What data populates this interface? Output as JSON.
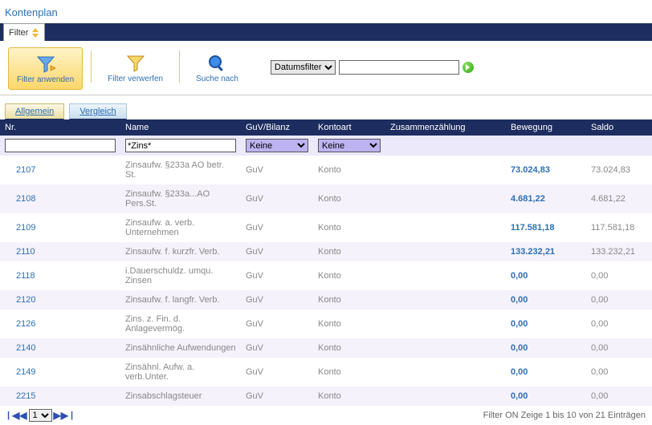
{
  "title": "Kontenplan",
  "filterTab": "Filter",
  "toolbar": {
    "apply": "Filter anwenden",
    "discard": "Filter verwerfen",
    "search": "Suche nach",
    "dateFilter": "Datumsfilter"
  },
  "tabs": {
    "allgemein": "Allgemein",
    "vergleich": "Vergleich"
  },
  "columns": {
    "nr": "Nr.",
    "name": "Name",
    "guv": "GuV/Bilanz",
    "kontoart": "Kontoart",
    "zus": "Zusammenzählung",
    "bew": "Bewegung",
    "saldo": "Saldo"
  },
  "filters": {
    "nr": "",
    "name": "*Zins*",
    "guv": "Keine",
    "kontoart": "Keine"
  },
  "rows": [
    {
      "nr": "2107",
      "name": "Zinsaufw. §233a AO betr. St.",
      "guv": "GuV",
      "kontoart": "Konto",
      "zus": "",
      "bew": "73.024,83",
      "saldo": "73.024,83"
    },
    {
      "nr": "2108",
      "name": "Zinsaufw. §233a...AO Pers.St.",
      "guv": "GuV",
      "kontoart": "Konto",
      "zus": "",
      "bew": "4.681,22",
      "saldo": "4.681,22"
    },
    {
      "nr": "2109",
      "name": "Zinsaufw. a. verb. Unternehmen",
      "guv": "GuV",
      "kontoart": "Konto",
      "zus": "",
      "bew": "117.581,18",
      "saldo": "117.581,18"
    },
    {
      "nr": "2110",
      "name": "Zinsaufw. f. kurzfr. Verb.",
      "guv": "GuV",
      "kontoart": "Konto",
      "zus": "",
      "bew": "133.232,21",
      "saldo": "133.232,21"
    },
    {
      "nr": "2118",
      "name": "i.Dauerschuldz. umqu. Zinsen",
      "guv": "GuV",
      "kontoart": "Konto",
      "zus": "",
      "bew": "0,00",
      "saldo": "0,00"
    },
    {
      "nr": "2120",
      "name": "Zinsaufw. f. langfr. Verb.",
      "guv": "GuV",
      "kontoart": "Konto",
      "zus": "",
      "bew": "0,00",
      "saldo": "0,00"
    },
    {
      "nr": "2126",
      "name": "Zins. z. Fin. d. Anlagevermög.",
      "guv": "GuV",
      "kontoart": "Konto",
      "zus": "",
      "bew": "0,00",
      "saldo": "0,00"
    },
    {
      "nr": "2140",
      "name": "Zinsähnliche Aufwendungen",
      "guv": "GuV",
      "kontoart": "Konto",
      "zus": "",
      "bew": "0,00",
      "saldo": "0,00"
    },
    {
      "nr": "2149",
      "name": "Zinsähnl. Aufw. a. verb.Unter.",
      "guv": "GuV",
      "kontoart": "Konto",
      "zus": "",
      "bew": "0,00",
      "saldo": "0,00"
    },
    {
      "nr": "2215",
      "name": "Zinsabschlagsteuer",
      "guv": "GuV",
      "kontoart": "Konto",
      "zus": "",
      "bew": "0,00",
      "saldo": "0,00"
    }
  ],
  "pager": {
    "current": "1"
  },
  "footer": "Filter ON  Zeige 1 bis 10 von 21 Einträgen"
}
